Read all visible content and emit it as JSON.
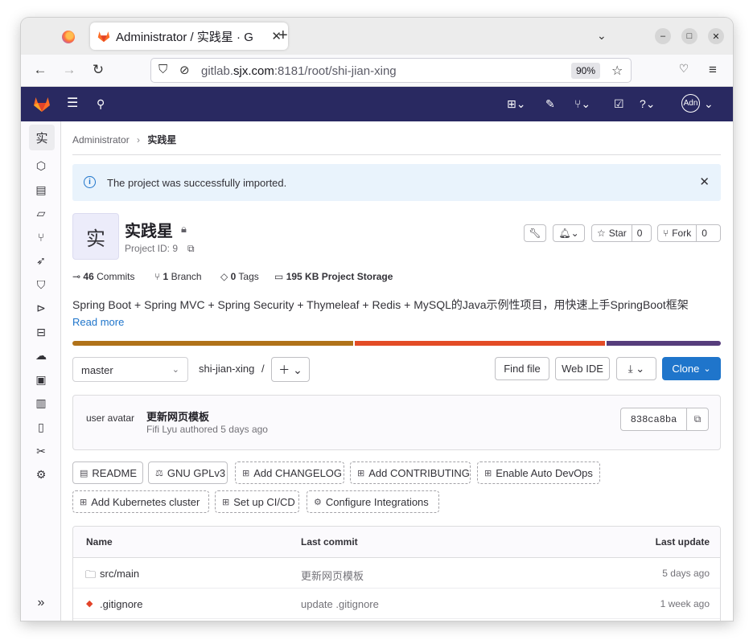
{
  "browser": {
    "tab_title": "Administrator / 实践星 · G",
    "url_prefix": "gitlab.",
    "url_domain": "sjx.com",
    "url_suffix": ":8181/root/shi-jian-xing",
    "zoom": "90%"
  },
  "breadcrumb": {
    "parent": "Administrator",
    "current": "实践星"
  },
  "alert": {
    "text": "The project was successfully imported."
  },
  "project": {
    "avatar_letter": "实",
    "name": "实践星",
    "id_label": "Project ID: 9",
    "star_label": "Star",
    "star_count": "0",
    "fork_label": "Fork",
    "fork_count": "0",
    "stats": {
      "commits_num": "46",
      "commits_label": "Commits",
      "branch_num": "1",
      "branch_label": "Branch",
      "tags_num": "0",
      "tags_label": "Tags",
      "storage_num": "195 KB",
      "storage_label": "Project Storage"
    },
    "description": "Spring Boot + Spring MVC + Spring Security + Thymeleaf + Redis + MySQL的Java示例性项目，用快速上手SpringBoot框架",
    "read_more": "Read more",
    "language_colors": [
      "#b07219",
      "#e34c26",
      "#563d7c"
    ]
  },
  "repo_toolbar": {
    "branch": "master",
    "path": "shi-jian-xing",
    "path_sep": "/",
    "find_file": "Find file",
    "web_ide": "Web IDE",
    "clone": "Clone"
  },
  "last_commit": {
    "avatar_alt": "user avatar",
    "title": "更新网页模板",
    "meta": "Fifi Lyu authored 5 days ago",
    "sha": "838ca8ba"
  },
  "quick_actions": {
    "readme": "README",
    "license": "GNU GPLv3",
    "changelog": "Add CHANGELOG",
    "contributing": "Add CONTRIBUTING",
    "autodevops": "Enable Auto DevOps",
    "kubernetes": "Add Kubernetes cluster",
    "cicd": "Set up CI/CD",
    "integrations": "Configure Integrations"
  },
  "file_table": {
    "headers": {
      "name": "Name",
      "commit": "Last commit",
      "update": "Last update"
    },
    "rows": [
      {
        "name": "src/main",
        "commit": "更新网页模板",
        "update": "5 days ago"
      },
      {
        "name": ".gitignore",
        "commit": "update .gitignore",
        "update": "1 week ago"
      }
    ]
  }
}
